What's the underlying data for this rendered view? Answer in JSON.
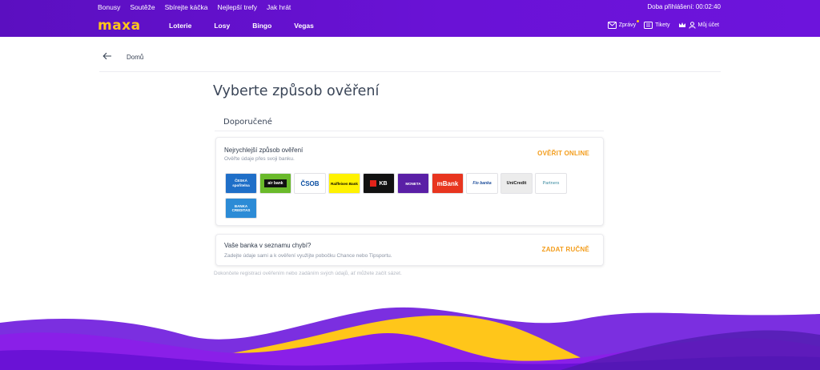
{
  "header": {
    "top_links": [
      "Bonusy",
      "Soutěže",
      "Sbírejte káčka",
      "Nejlepší trefy",
      "Jak hrát"
    ],
    "login_time": "Doba přihlášení: 00:02:40",
    "logo": "maxa",
    "main_links": [
      "Loterie",
      "Losy",
      "Bingo",
      "Vegas"
    ],
    "messages_label": "Zprávy",
    "tickets_label": "Tikety",
    "account_label": "Můj účet",
    "accent_color": "#ffc61a",
    "brand_color": "#6a12d6"
  },
  "breadcrumb": {
    "home": "Domů"
  },
  "page": {
    "title": "Vyberte způsob ověření",
    "section_title": "Doporučené",
    "online_card": {
      "title": "Nejrychlejší způsob ověření",
      "subtitle": "Ověřte údaje přes svoji banku.",
      "action": "OVĚŘIT ONLINE",
      "banks": [
        {
          "name": "ČESKÁ spořitelna",
          "bg": "#1f6fc8",
          "fg": "#ffffff"
        },
        {
          "name": "air bank",
          "bg": "#6aba2b",
          "fg": "#ffffff"
        },
        {
          "name": "ČSOB",
          "bg": "#ffffff",
          "fg": "#0a4ea1"
        },
        {
          "name": "Raiffeisen Bank",
          "bg": "#fff200",
          "fg": "#000000"
        },
        {
          "name": "KB",
          "bg": "#111111",
          "fg": "#ffffff"
        },
        {
          "name": "MONETA",
          "bg": "#5a1fa6",
          "fg": "#ffffff"
        },
        {
          "name": "mBank",
          "bg": "#e8351f",
          "fg": "#ffffff"
        },
        {
          "name": "Fio banka",
          "bg": "#ffffff",
          "fg": "#1d4d9a"
        },
        {
          "name": "UniCredit",
          "bg": "#ececec",
          "fg": "#1a1a1a"
        },
        {
          "name": "Partners",
          "bg": "#ffffff",
          "fg": "#3a8aa0"
        },
        {
          "name": "BANKA CREDITAS",
          "bg": "#2c8bd6",
          "fg": "#ffffff"
        }
      ]
    },
    "manual_card": {
      "title": "Vaše banka v seznamu chybí?",
      "subtitle": "Zadejte údaje sami a k ověření využijte pobočku Chance nebo Tipsportu.",
      "action": "ZADAT RUČNĚ"
    },
    "footnote": "Dokončete registraci ověřením nebo zadáním svých údajů, ať můžete začít sázet."
  }
}
